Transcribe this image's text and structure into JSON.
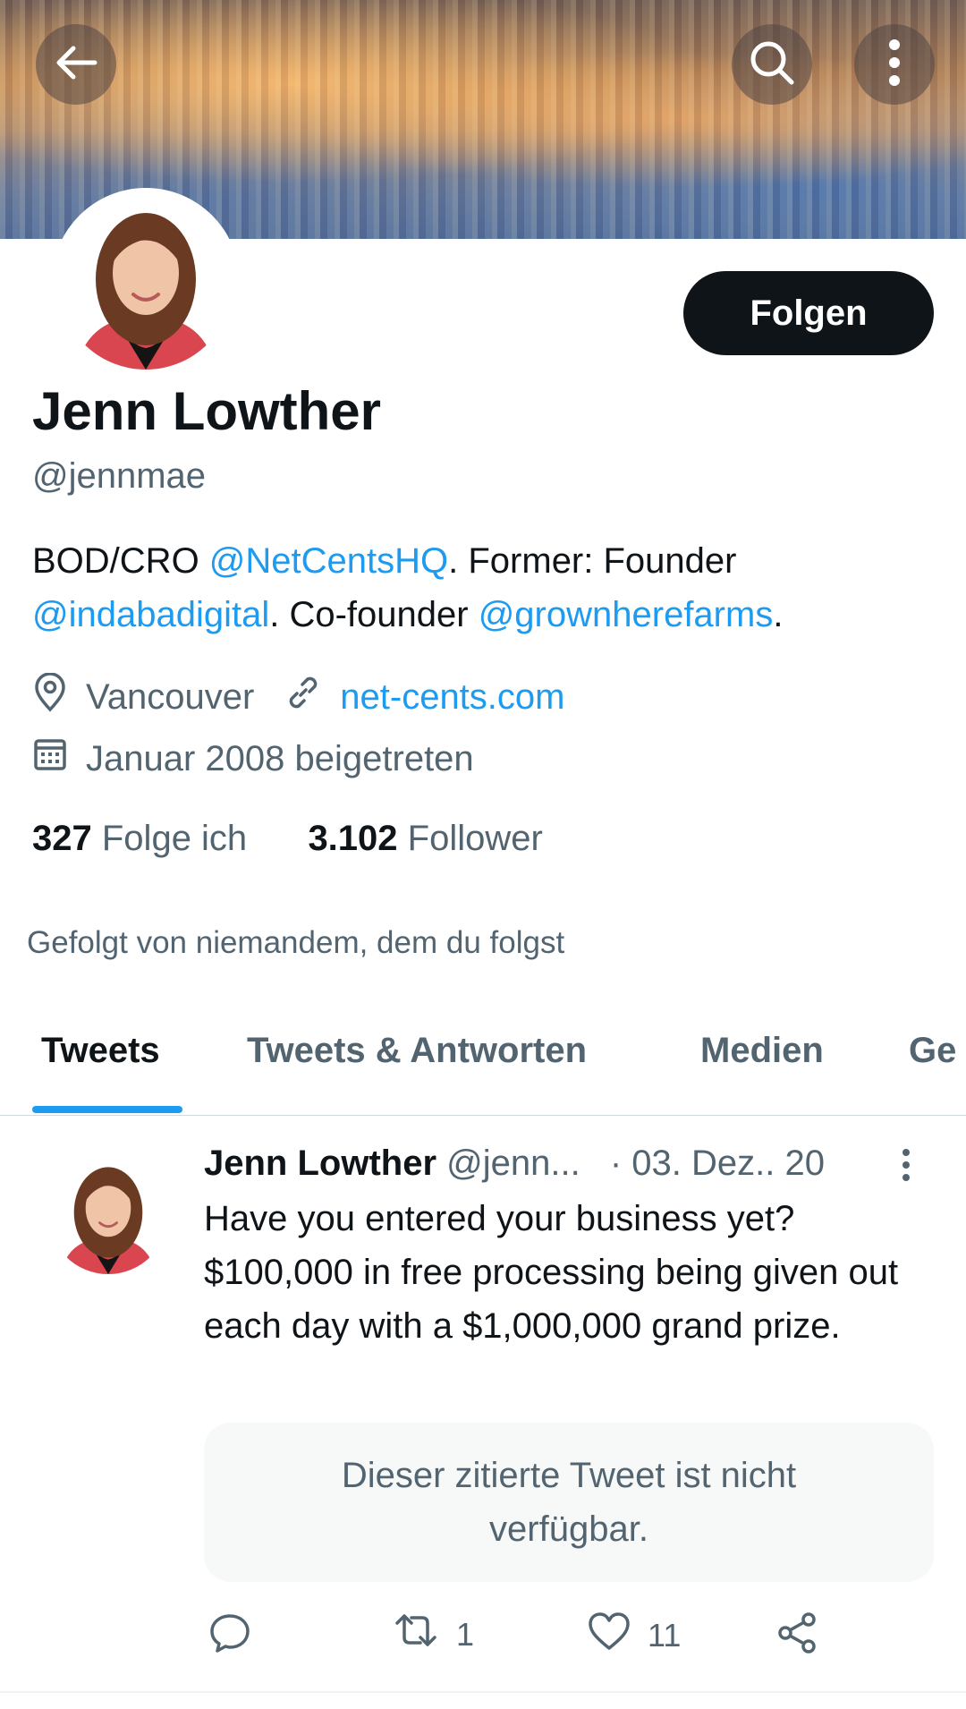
{
  "header": {
    "back_label": "back",
    "search_label": "search",
    "more_label": "more"
  },
  "profile": {
    "follow_label": "Folgen",
    "name": "Jenn Lowther",
    "handle": "@jennmae",
    "bio": {
      "part1": "BOD/CRO ",
      "mention1": "@NetCentsHQ",
      "part2": ". Former: Founder ",
      "mention2": "@indabadigital",
      "part3": ". Co-founder ",
      "mention3": "@grownherefarms",
      "part4": "."
    },
    "location": "Vancouver",
    "website": "net-cents.com",
    "joined": "Januar 2008 beigetreten",
    "following_count": "327",
    "following_label": "Folge ich",
    "followers_count": "3.102",
    "followers_label": "Follower",
    "followed_by": "Gefolgt von niemandem, dem du folgst"
  },
  "tabs": [
    {
      "label": "Tweets"
    },
    {
      "label": "Tweets & Antworten"
    },
    {
      "label": "Medien"
    },
    {
      "label": "Ge"
    }
  ],
  "tweet": {
    "author_name": "Jenn Lowther",
    "author_handle": "@jenn...",
    "date": "· 03. Dez.. 20",
    "text": "Have you entered your business yet? $100,000 in free processing being given out each day with a $1,000,000 grand prize.",
    "quote_unavailable": "Dieser zitierte Tweet ist nicht verfügbar.",
    "retweet_count": "1",
    "like_count": "11"
  },
  "colors": {
    "accent": "#1d9bf0",
    "text_primary": "#0f1419",
    "text_secondary": "#536471"
  }
}
